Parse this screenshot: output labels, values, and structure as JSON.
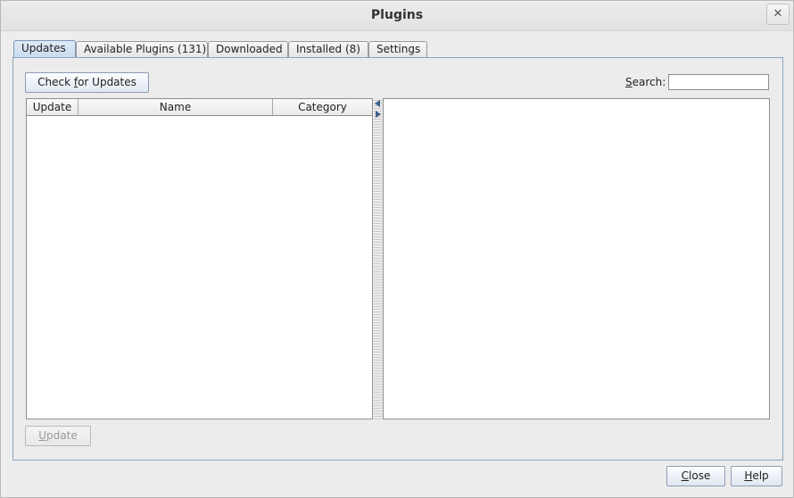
{
  "window": {
    "title": "Plugins",
    "close_glyph": "✕"
  },
  "tabs": [
    {
      "label": "Updates",
      "active": true
    },
    {
      "label": "Available Plugins (131)",
      "active": false
    },
    {
      "label": "Downloaded",
      "active": false
    },
    {
      "label": "Installed (8)",
      "active": false
    },
    {
      "label": "Settings",
      "active": false
    }
  ],
  "toolbar": {
    "check_updates_pre": "Check ",
    "check_updates_mn": "f",
    "check_updates_post": "or Updates",
    "search_pre": "",
    "search_mn": "S",
    "search_post": "earch:",
    "search_value": ""
  },
  "table": {
    "columns": [
      "Update",
      "Name",
      "Category"
    ],
    "rows": []
  },
  "footer": {
    "update_mn": "U",
    "update_post": "pdate",
    "close_mn": "C",
    "close_post": "lose",
    "help_mn": "H",
    "help_post": "elp"
  },
  "colors": {
    "active_tab": "#c9dbef",
    "panel_border": "#8aa3c2"
  }
}
